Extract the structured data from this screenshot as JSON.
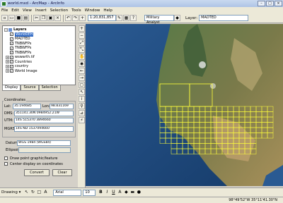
{
  "window": {
    "title": "world.mxd - ArcMap - ArcInfo"
  },
  "menu": [
    "File",
    "Edit",
    "View",
    "Insert",
    "Selection",
    "Tools",
    "Window",
    "Help"
  ],
  "toolbar": {
    "scale": "1:20,831,857",
    "tool": "Military Analyst",
    "layer_label": "Layer:",
    "layer": "MADTED"
  },
  "toc": {
    "items": [
      {
        "label": "Layers",
        "expand": "−"
      },
      {
        "label": "World0EH",
        "checked": true,
        "selected": true
      },
      {
        "label": "MADTED",
        "checked": true
      },
      {
        "label": "TNBWFPs",
        "checked": true
      },
      {
        "label": "TNBWFPs",
        "checked": true
      },
      {
        "label": "TNBWFPs",
        "checked": true
      },
      {
        "label": "wswarth.tif",
        "checked": true,
        "expand": "+"
      },
      {
        "label": "Countries",
        "checked": true,
        "expand": "+"
      },
      {
        "label": "country",
        "checked": true,
        "expand": "+"
      },
      {
        "label": "World Image",
        "checked": true,
        "expand": "+"
      }
    ],
    "tabs": [
      "Display",
      "Source",
      "Selection"
    ]
  },
  "coords": {
    "group_label": "Coordinates",
    "lat_label": "Lat:",
    "lat": "35.194685",
    "lon_label": "Lon:",
    "lon": "98.831169",
    "dms_label": "DMS:",
    "dms": "351141.30N 0984952.21W",
    "utm_label": "UTM:",
    "utm": "14S 515370 3894660",
    "mgrs_label": "MGRS:",
    "mgrs": "14S ND 1537094660",
    "datum_label": "Datum:",
    "datum": "WGS 1984 (WGS84)",
    "ellipsoid_label": "Ellipsoid:",
    "draw_point": "Draw point graphic/feature",
    "center_display": "Center display on coordinates",
    "convert": "Convert",
    "clear": "Clear"
  },
  "drawing": {
    "label": "Drawing ▾",
    "font": "Arial",
    "size": "10",
    "bold": "B",
    "italic": "I",
    "underline": "U",
    "text_tool": "A"
  },
  "status": {
    "coords": "98°49'52\"W  35°11'41.30\"N"
  },
  "colors": {
    "ocean": "#1e4a7a",
    "land": "#4a6a3a",
    "grid": "#ffff3a"
  }
}
